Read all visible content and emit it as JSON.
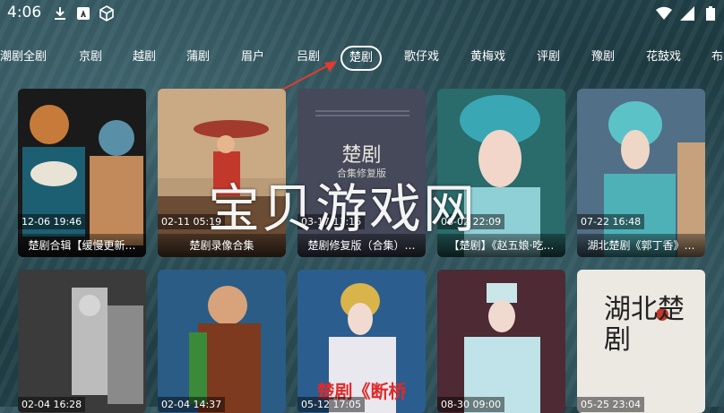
{
  "status_bar": {
    "time": "4:06",
    "left_icons": [
      "download-icon",
      "app-icon",
      "cube-icon"
    ],
    "right_icons": [
      "wifi-icon",
      "signal-icon",
      "battery-icon"
    ]
  },
  "tabs": [
    {
      "label": "潮剧全剧"
    },
    {
      "label": "京剧"
    },
    {
      "label": "越剧"
    },
    {
      "label": "蒲剧"
    },
    {
      "label": "眉户"
    },
    {
      "label": "吕剧"
    },
    {
      "label": "楚剧",
      "active": true
    },
    {
      "label": "歌仔戏"
    },
    {
      "label": "黄梅戏"
    },
    {
      "label": "评剧"
    },
    {
      "label": "豫剧"
    },
    {
      "label": "花鼓戏"
    },
    {
      "label": "布"
    }
  ],
  "cards_row1": [
    {
      "time": "12-06 19:46",
      "title": "楚剧合辑【缓慢更新…"
    },
    {
      "time": "02-11 05:19",
      "title": "楚剧录像合集"
    },
    {
      "time": "03-17 13:16",
      "title": "楚剧修复版（合集）…",
      "cover_title": "楚剧",
      "cover_sub": "合集修复版"
    },
    {
      "time": "06-02 22:09",
      "title": "【楚剧】《赵五娘·吃…"
    },
    {
      "time": "07-22 16:48",
      "title": "湖北楚剧《郭丁香》…"
    }
  ],
  "cards_row2": [
    {
      "time": "02-04 16:28"
    },
    {
      "time": "02-04 14:37"
    },
    {
      "time": "05-12 17:05",
      "cover_text": "楚剧《断桥"
    },
    {
      "time": "08-30 09:00"
    },
    {
      "time": "05-25 23:04",
      "cover_text": "湖北楚剧"
    }
  ],
  "watermark": "宝贝游戏网",
  "colors": {
    "accent": "#ffffff",
    "arrow": "#e23b2e"
  }
}
